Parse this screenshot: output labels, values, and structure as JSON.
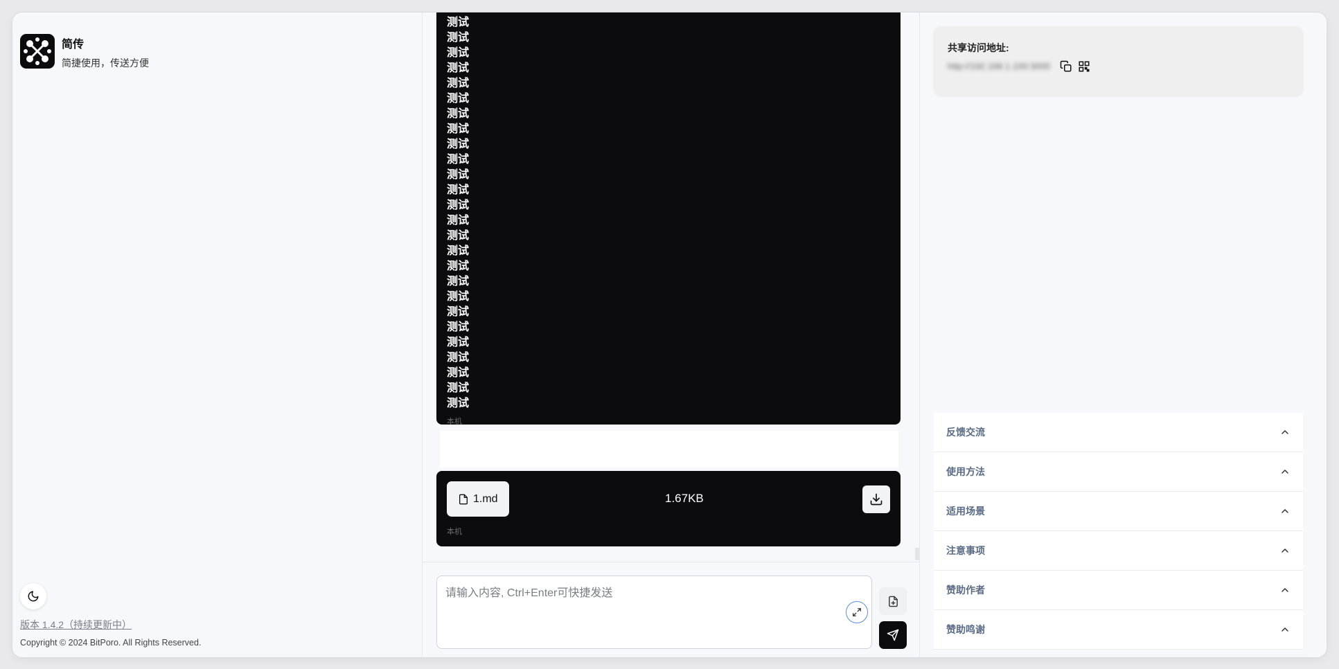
{
  "app": {
    "title": "简传",
    "subtitle": "简捷使用，传送方便",
    "version": "版本 1.4.2（持续更新中）",
    "copyright": "Copyright © 2024 BitPoro. All Rights Reserved."
  },
  "messages": {
    "text_lines": [
      "测试",
      "测试",
      "测试",
      "测试",
      "测试",
      "测试",
      "测试",
      "测试",
      "测试",
      "测试",
      "测试",
      "测试",
      "测试",
      "测试",
      "测试",
      "测试",
      "测试",
      "测试",
      "测试",
      "测试",
      "测试",
      "测试",
      "测试",
      "测试",
      "测试",
      "测试"
    ],
    "text_source": "本机",
    "file_name": "1.md",
    "file_size": "1.67KB",
    "file_source": "本机"
  },
  "composer": {
    "placeholder": "请输入内容, Ctrl+Enter可快捷发送"
  },
  "share": {
    "title": "共享访问地址:",
    "url": "http://192.168.1.100:3000"
  },
  "accordion": [
    {
      "label": "反馈交流"
    },
    {
      "label": "使用方法"
    },
    {
      "label": "适用场景"
    },
    {
      "label": "注意事项"
    },
    {
      "label": "赞助作者"
    },
    {
      "label": "赞助鸣谢"
    }
  ],
  "icons": {
    "logo": "app-logo-icon",
    "theme": "moon-icon",
    "file": "file-icon",
    "download": "download-icon",
    "magic": "expand-icon",
    "upload": "file-upload-icon",
    "send": "send-icon",
    "copy": "copy-icon",
    "qr": "qr-code-icon",
    "chevron": "chevron-up-icon"
  }
}
